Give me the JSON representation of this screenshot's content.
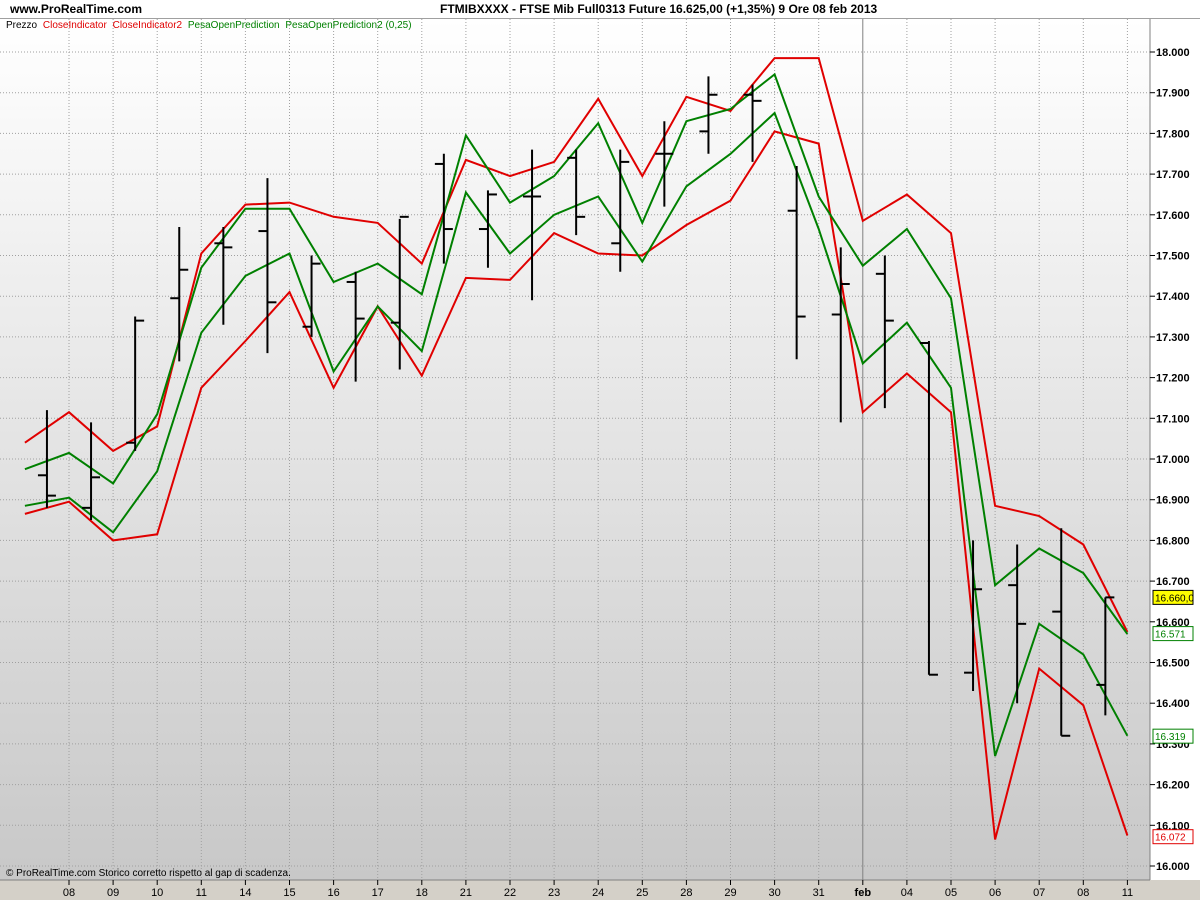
{
  "header": {
    "site": "www.ProRealTime.com",
    "title": "FTMIBXXXX - FTSE Mib Full0313 Future     16.625,00 (+1,35%)    9 Ore   08 feb 2013"
  },
  "legend": [
    {
      "label": "Prezzo",
      "color": "#000000"
    },
    {
      "label": "CloseIndicator",
      "color": "#e00000"
    },
    {
      "label": "CloseIndicator2",
      "color": "#e00000"
    },
    {
      "label": "PesaOpenPrediction",
      "color": "#008000"
    },
    {
      "label": "PesaOpenPrediction2 (0,25)",
      "color": "#008000"
    }
  ],
  "copyright": "© ProRealTime.com  Storico corretto rispetto al gap di scadenza.",
  "value_tags": [
    {
      "text": "16.660,0",
      "value": 16660,
      "color": "#000000",
      "bg": "#ffff00"
    },
    {
      "text": "16.571",
      "value": 16571,
      "color": "#008000",
      "bg": "#ffffff"
    },
    {
      "text": "16.319",
      "value": 16319,
      "color": "#008000",
      "bg": "#ffffff"
    },
    {
      "text": "16.072",
      "value": 16072,
      "color": "#e00000",
      "bg": "#ffffff"
    }
  ],
  "chart_data": {
    "type": "line",
    "ylim": [
      15980,
      18060
    ],
    "y_ticks": [
      {
        "value": 16000,
        "label": "16.000"
      },
      {
        "value": 16100,
        "label": "16.100"
      },
      {
        "value": 16200,
        "label": "16.200"
      },
      {
        "value": 16300,
        "label": "16.300"
      },
      {
        "value": 16400,
        "label": "16.400"
      },
      {
        "value": 16500,
        "label": "16.500"
      },
      {
        "value": 16600,
        "label": "16.600"
      },
      {
        "value": 16700,
        "label": "16.700"
      },
      {
        "value": 16800,
        "label": "16.800"
      },
      {
        "value": 16900,
        "label": "16.900"
      },
      {
        "value": 17000,
        "label": "17.000"
      },
      {
        "value": 17100,
        "label": "17.100"
      },
      {
        "value": 17200,
        "label": "17.200"
      },
      {
        "value": 17300,
        "label": "17.300"
      },
      {
        "value": 17400,
        "label": "17.400"
      },
      {
        "value": 17500,
        "label": "17.500"
      },
      {
        "value": 17600,
        "label": "17.600"
      },
      {
        "value": 17700,
        "label": "17.700"
      },
      {
        "value": 17800,
        "label": "17.800"
      },
      {
        "value": 17900,
        "label": "17.900"
      },
      {
        "value": 18000,
        "label": "18.000"
      }
    ],
    "x_labels": [
      "08",
      "09",
      "10",
      "11",
      "14",
      "15",
      "16",
      "17",
      "18",
      "21",
      "22",
      "23",
      "24",
      "25",
      "28",
      "29",
      "30",
      "31",
      "feb",
      "04",
      "05",
      "06",
      "07",
      "08",
      "11"
    ],
    "month_separator_label": "feb",
    "grid": true,
    "bars": [
      {
        "h": 17120,
        "l": 16880,
        "o": 16960,
        "c": 16910
      },
      {
        "h": 17090,
        "l": 16850,
        "o": 16880,
        "c": 16955
      },
      {
        "h": 17350,
        "l": 17020,
        "o": 17040,
        "c": 17340
      },
      {
        "h": 17570,
        "l": 17240,
        "o": 17395,
        "c": 17465
      },
      {
        "h": 17570,
        "l": 17330,
        "o": 17530,
        "c": 17520
      },
      {
        "h": 17690,
        "l": 17260,
        "o": 17560,
        "c": 17385
      },
      {
        "h": 17500,
        "l": 17300,
        "o": 17325,
        "c": 17480
      },
      {
        "h": 17460,
        "l": 17190,
        "o": 17435,
        "c": 17345
      },
      {
        "h": 17590,
        "l": 17220,
        "o": 17335,
        "c": 17595
      },
      {
        "h": 17750,
        "l": 17480,
        "o": 17725,
        "c": 17565
      },
      {
        "h": 17660,
        "l": 17470,
        "o": 17565,
        "c": 17650
      },
      {
        "h": 17760,
        "l": 17390,
        "o": 17645,
        "c": 17645
      },
      {
        "h": 17760,
        "l": 17550,
        "o": 17740,
        "c": 17595
      },
      {
        "h": 17760,
        "l": 17460,
        "o": 17530,
        "c": 17730
      },
      {
        "h": 17830,
        "l": 17620,
        "o": 17750,
        "c": 17750
      },
      {
        "h": 17940,
        "l": 17750,
        "o": 17805,
        "c": 17895
      },
      {
        "h": 17920,
        "l": 17730,
        "o": 17895,
        "c": 17880
      },
      {
        "h": 17720,
        "l": 17245,
        "o": 17610,
        "c": 17350
      },
      {
        "h": 17520,
        "l": 17090,
        "o": 17355,
        "c": 17430
      },
      {
        "h": 17500,
        "l": 17125,
        "o": 17455,
        "c": 17340
      },
      {
        "h": 17290,
        "l": 16470,
        "o": 17285,
        "c": 16470
      },
      {
        "h": 16800,
        "l": 16430,
        "o": 16475,
        "c": 16680
      },
      {
        "h": 16790,
        "l": 16400,
        "o": 16690,
        "c": 16595
      },
      {
        "h": 16830,
        "l": 16320,
        "o": 16625,
        "c": 16320
      },
      {
        "h": 16660,
        "l": 16370,
        "o": 16445,
        "c": 16660
      }
    ],
    "bar_x_index_offset": -0.5,
    "series": [
      {
        "name": "CloseIndicator",
        "color": "#e00000",
        "x_start": -1,
        "values": [
          17040,
          17115,
          17020,
          17080,
          17505,
          17625,
          17630,
          17595,
          17580,
          17480,
          17735,
          17695,
          17730,
          17885,
          17695,
          17890,
          17855,
          17985,
          17985,
          17585,
          17650,
          17555,
          16885,
          16860,
          16790,
          16575
        ]
      },
      {
        "name": "CloseIndicator2",
        "color": "#e00000",
        "x_start": -1,
        "values": [
          16865,
          16895,
          16800,
          16815,
          17175,
          17290,
          17410,
          17175,
          17375,
          17205,
          17445,
          17440,
          17555,
          17505,
          17500,
          17575,
          17635,
          17805,
          17775,
          17115,
          17210,
          17115,
          16065,
          16485,
          16395,
          16075
        ]
      },
      {
        "name": "PesaOpenPrediction",
        "color": "#008000",
        "x_start": -1,
        "values": [
          16975,
          17015,
          16940,
          17110,
          17470,
          17615,
          17615,
          17435,
          17480,
          17405,
          17795,
          17630,
          17695,
          17825,
          17580,
          17830,
          17860,
          17945,
          17645,
          17475,
          17565,
          17395,
          16690,
          16780,
          16720,
          16570
        ]
      },
      {
        "name": "PesaOpenPrediction2 (0,25)",
        "color": "#008000",
        "x_start": -1,
        "values": [
          16885,
          16905,
          16820,
          16970,
          17310,
          17450,
          17505,
          17215,
          17375,
          17265,
          17655,
          17505,
          17600,
          17645,
          17485,
          17670,
          17750,
          17850,
          17565,
          17235,
          17335,
          17175,
          16270,
          16595,
          16520,
          16320
        ]
      }
    ]
  }
}
